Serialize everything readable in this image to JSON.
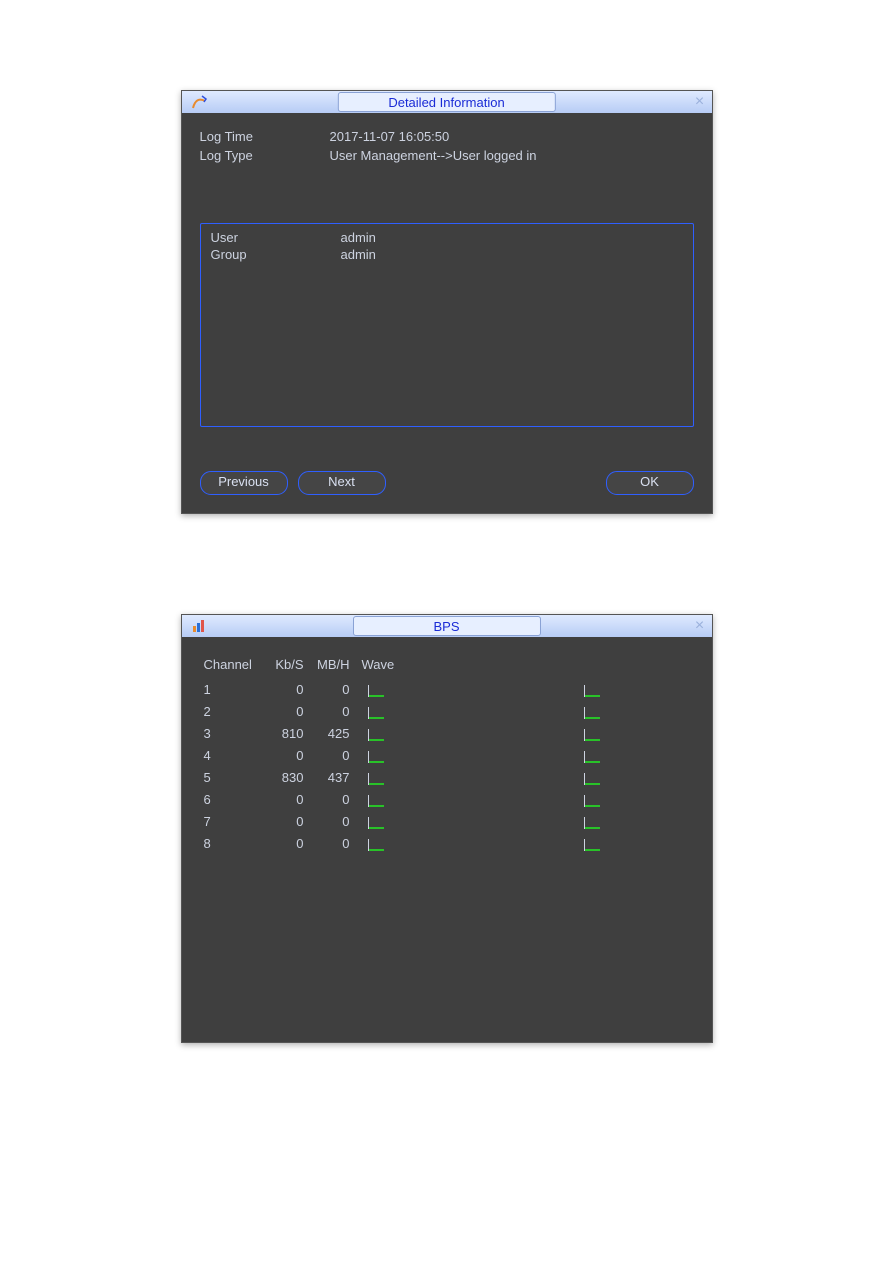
{
  "detailed": {
    "title": "Detailed Information",
    "log_time_label": "Log Time",
    "log_time_value": "2017-11-07 16:05:50",
    "log_type_label": "Log Type",
    "log_type_value": "User Management-->User logged in",
    "user_label": "User",
    "user_value": "admin",
    "group_label": "Group",
    "group_value": "admin",
    "buttons": {
      "previous": "Previous",
      "next": "Next",
      "ok": "OK"
    }
  },
  "bps": {
    "title": "BPS",
    "headers": {
      "channel": "Channel",
      "kbs": "Kb/S",
      "mbh": "MB/H",
      "wave": "Wave"
    },
    "rows": [
      {
        "channel": "1",
        "kbs": "0",
        "mbh": "0"
      },
      {
        "channel": "2",
        "kbs": "0",
        "mbh": "0"
      },
      {
        "channel": "3",
        "kbs": "810",
        "mbh": "425"
      },
      {
        "channel": "4",
        "kbs": "0",
        "mbh": "0"
      },
      {
        "channel": "5",
        "kbs": "830",
        "mbh": "437"
      },
      {
        "channel": "6",
        "kbs": "0",
        "mbh": "0"
      },
      {
        "channel": "7",
        "kbs": "0",
        "mbh": "0"
      },
      {
        "channel": "8",
        "kbs": "0",
        "mbh": "0"
      }
    ]
  }
}
